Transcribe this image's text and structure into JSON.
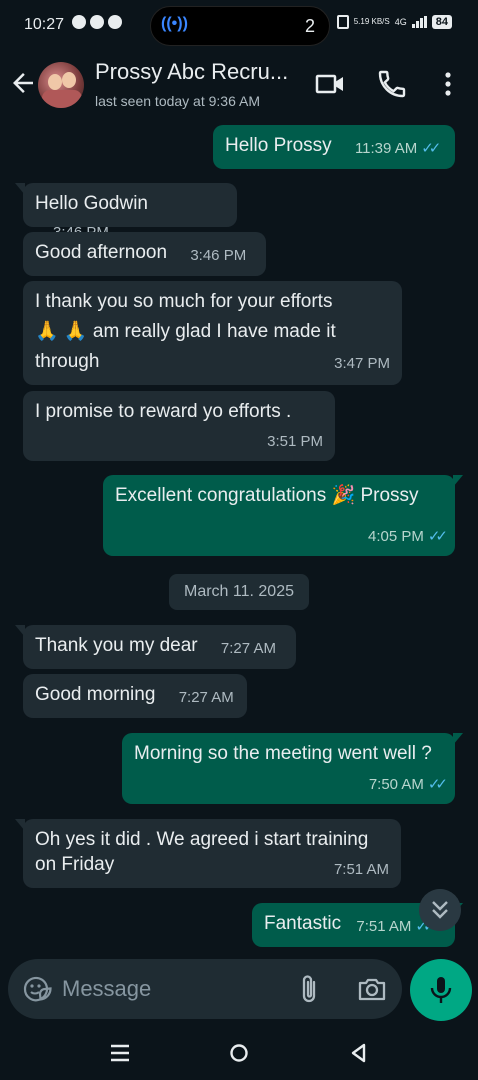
{
  "status_bar": {
    "time": "10:27",
    "pill_count": "2",
    "speed": "5.19 KB/S",
    "network": "4G",
    "battery": "84"
  },
  "header": {
    "contact_name": "Prossy Abc Recru...",
    "last_seen": "last seen today at 9:36 AM"
  },
  "messages": [
    {
      "dir": "out",
      "text": "Hello Prossy",
      "time": "11:39 AM",
      "read": true
    },
    {
      "dir": "in",
      "text": "Hello Godwin",
      "time": "3:46 PM"
    },
    {
      "dir": "in",
      "text": "Good afternoon",
      "time": "3:46 PM"
    },
    {
      "dir": "in",
      "text": "I thank you so much for your efforts 🙏 🙏 am really glad I have made it through",
      "line1": "I thank you so much for your efforts",
      "line2": "🙏 🙏  am really glad I have made it",
      "line3": "through",
      "time": "3:47 PM"
    },
    {
      "dir": "in",
      "text": "I promise to reward yo efforts .",
      "time": "3:51 PM"
    },
    {
      "dir": "out",
      "text": "Excellent congratulations 🎉 Prossy",
      "time": "4:05 PM",
      "read": true
    },
    {
      "dir": "in",
      "text": "Thank you my dear",
      "time": "7:27 AM"
    },
    {
      "dir": "in",
      "text": "Good morning",
      "time": "7:27 AM"
    },
    {
      "dir": "out",
      "text": "Morning so the meeting went well ?",
      "time": "7:50 AM",
      "read": true
    },
    {
      "dir": "in",
      "text": "Oh yes it did . We agreed i start training on Friday",
      "line1": "Oh yes it did . We agreed i start training",
      "line2": "on Friday",
      "time": "7:51 AM"
    },
    {
      "dir": "out",
      "text": "Fantastic",
      "time": "7:51 AM",
      "read": true
    }
  ],
  "date_separator": "March 11. 2025",
  "composer": {
    "placeholder": "Message"
  },
  "colors": {
    "background": "#0b141a",
    "incoming_bubble": "#202c33",
    "outgoing_bubble": "#005c4b",
    "accent": "#00a884",
    "read_ticks": "#53bdeb"
  },
  "icons": {
    "back": "arrow-left-icon",
    "video": "video-camera-icon",
    "call": "phone-icon",
    "menu": "more-vertical-icon",
    "emoji": "sticker-icon",
    "attach": "paperclip-icon",
    "camera": "camera-icon",
    "mic": "microphone-icon",
    "scroll": "double-chevron-down-icon"
  }
}
